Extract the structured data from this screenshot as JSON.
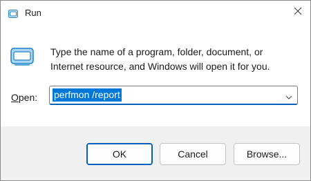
{
  "window": {
    "title": "Run",
    "app_icon": "run-app-icon",
    "close_icon": "close-icon"
  },
  "dialog": {
    "icon": "run-dialog-icon",
    "description": "Type the name of a program, folder, document, or Internet resource, and Windows will open it for you.",
    "open_label_accel": "O",
    "open_label_rest": "pen:",
    "open_value": "perfmon /report",
    "dropdown_icon": "chevron-down-icon"
  },
  "buttons": {
    "ok": "OK",
    "cancel": "Cancel",
    "browse": "Browse..."
  },
  "colors": {
    "accent": "#005fb8",
    "selection": "#0078d7",
    "footer": "#f0f0f0",
    "desktop": "#2e8a8c"
  }
}
